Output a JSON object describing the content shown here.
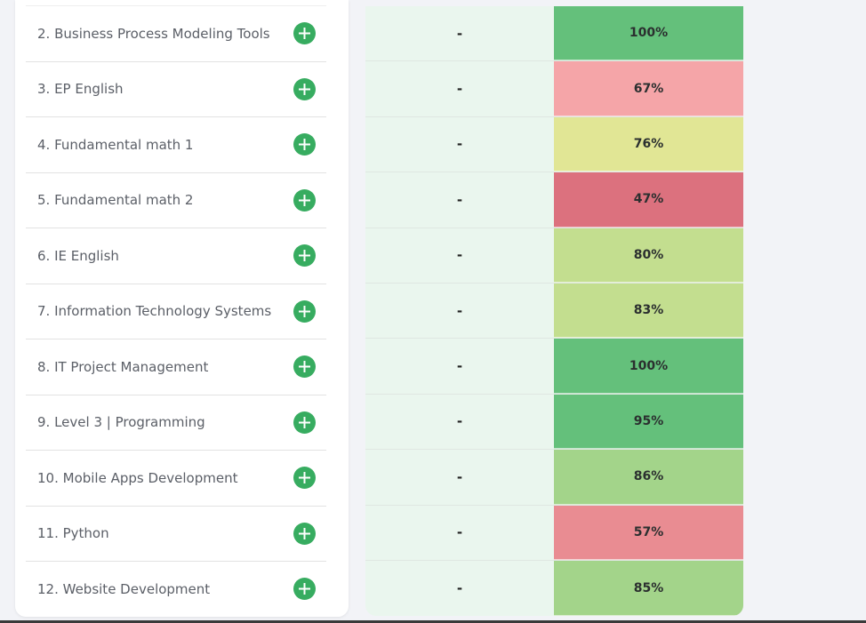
{
  "courses": [
    {
      "name": "2. Business Process Modeling Tools",
      "progress": "-",
      "grade": "100%",
      "color": "#64c07b"
    },
    {
      "name": "3. EP English",
      "progress": "-",
      "grade": "67%",
      "color": "#f5a5a8"
    },
    {
      "name": "4. Fundamental math 1",
      "progress": "-",
      "grade": "76%",
      "color": "#e1e695"
    },
    {
      "name": "5. Fundamental math 2",
      "progress": "-",
      "grade": "47%",
      "color": "#dc717e"
    },
    {
      "name": "6. IE English",
      "progress": "-",
      "grade": "80%",
      "color": "#c3de8f"
    },
    {
      "name": "7. Information Technology Systems",
      "progress": "-",
      "grade": "83%",
      "color": "#c3de8f"
    },
    {
      "name": "8. IT Project Management",
      "progress": "-",
      "grade": "100%",
      "color": "#64c07b"
    },
    {
      "name": "9. Level 3 | Programming",
      "progress": "-",
      "grade": "95%",
      "color": "#64c07b"
    },
    {
      "name": "10. Mobile Apps Development",
      "progress": "-",
      "grade": "86%",
      "color": "#a3d48a"
    },
    {
      "name": "11. Python",
      "progress": "-",
      "grade": "57%",
      "color": "#e98c92"
    },
    {
      "name": "12. Website Development",
      "progress": "-",
      "grade": "85%",
      "color": "#a3d48a"
    }
  ],
  "colors": {
    "accent": "#37ac60",
    "progress_bg": "#eaf6ee",
    "header_strip": "#9dd49e"
  }
}
